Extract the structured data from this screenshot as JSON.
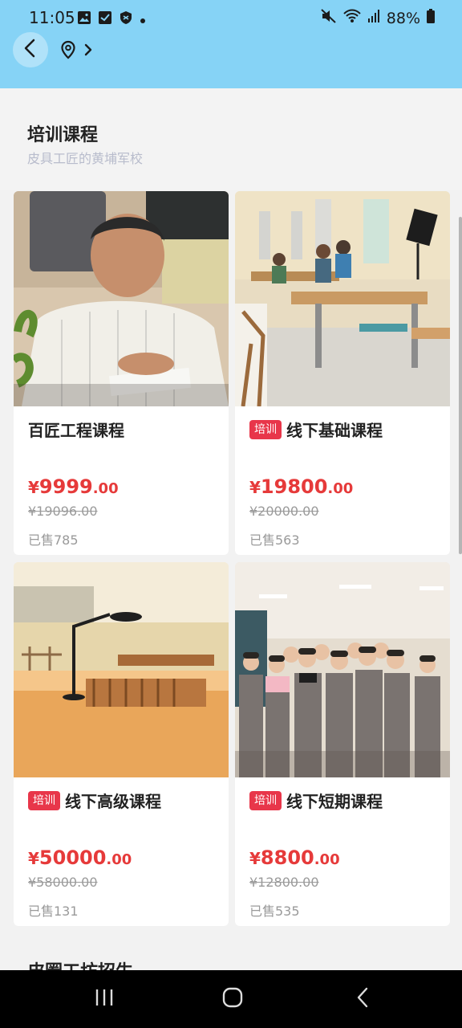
{
  "status": {
    "time": "11:05",
    "battery": "88%",
    "icons_left": [
      "image-icon",
      "check-box-icon",
      "shield-icon",
      "dot-icon"
    ],
    "icons_right": [
      "mute-icon",
      "wifi-icon",
      "signal-icon",
      "battery-icon"
    ]
  },
  "appbar": {
    "back_icon": "chevron-left-icon",
    "location_icon": "location-pin-icon",
    "chevron_icon": "chevron-right-icon"
  },
  "section": {
    "title": "培训课程",
    "subtitle": "皮具工匠的黄埔军校"
  },
  "products": [
    {
      "tag": "",
      "title": "百匠工程课程",
      "price_symbol": "¥",
      "price_int": "9999",
      "price_dec": ".00",
      "original": "¥19096.00",
      "sold": "已售785"
    },
    {
      "tag": "培训",
      "title": "线下基础课程",
      "price_symbol": "¥",
      "price_int": "19800",
      "price_dec": ".00",
      "original": "¥20000.00",
      "sold": "已售563"
    },
    {
      "tag": "培训",
      "title": "线下高级课程",
      "price_symbol": "¥",
      "price_int": "50000",
      "price_dec": ".00",
      "original": "¥58000.00",
      "sold": "已售131"
    },
    {
      "tag": "培训",
      "title": "线下短期课程",
      "price_symbol": "¥",
      "price_int": "8800",
      "price_dec": ".00",
      "original": "¥12800.00",
      "sold": "已售535"
    }
  ],
  "next_section": {
    "title": "皮圈工坊招生"
  },
  "navbar": {
    "icons": [
      "recent-apps-icon",
      "home-icon",
      "back-icon"
    ]
  },
  "colors": {
    "header_bg": "#86d3f6",
    "price_red": "#e63a3a",
    "tag_red": "#e8364a"
  }
}
